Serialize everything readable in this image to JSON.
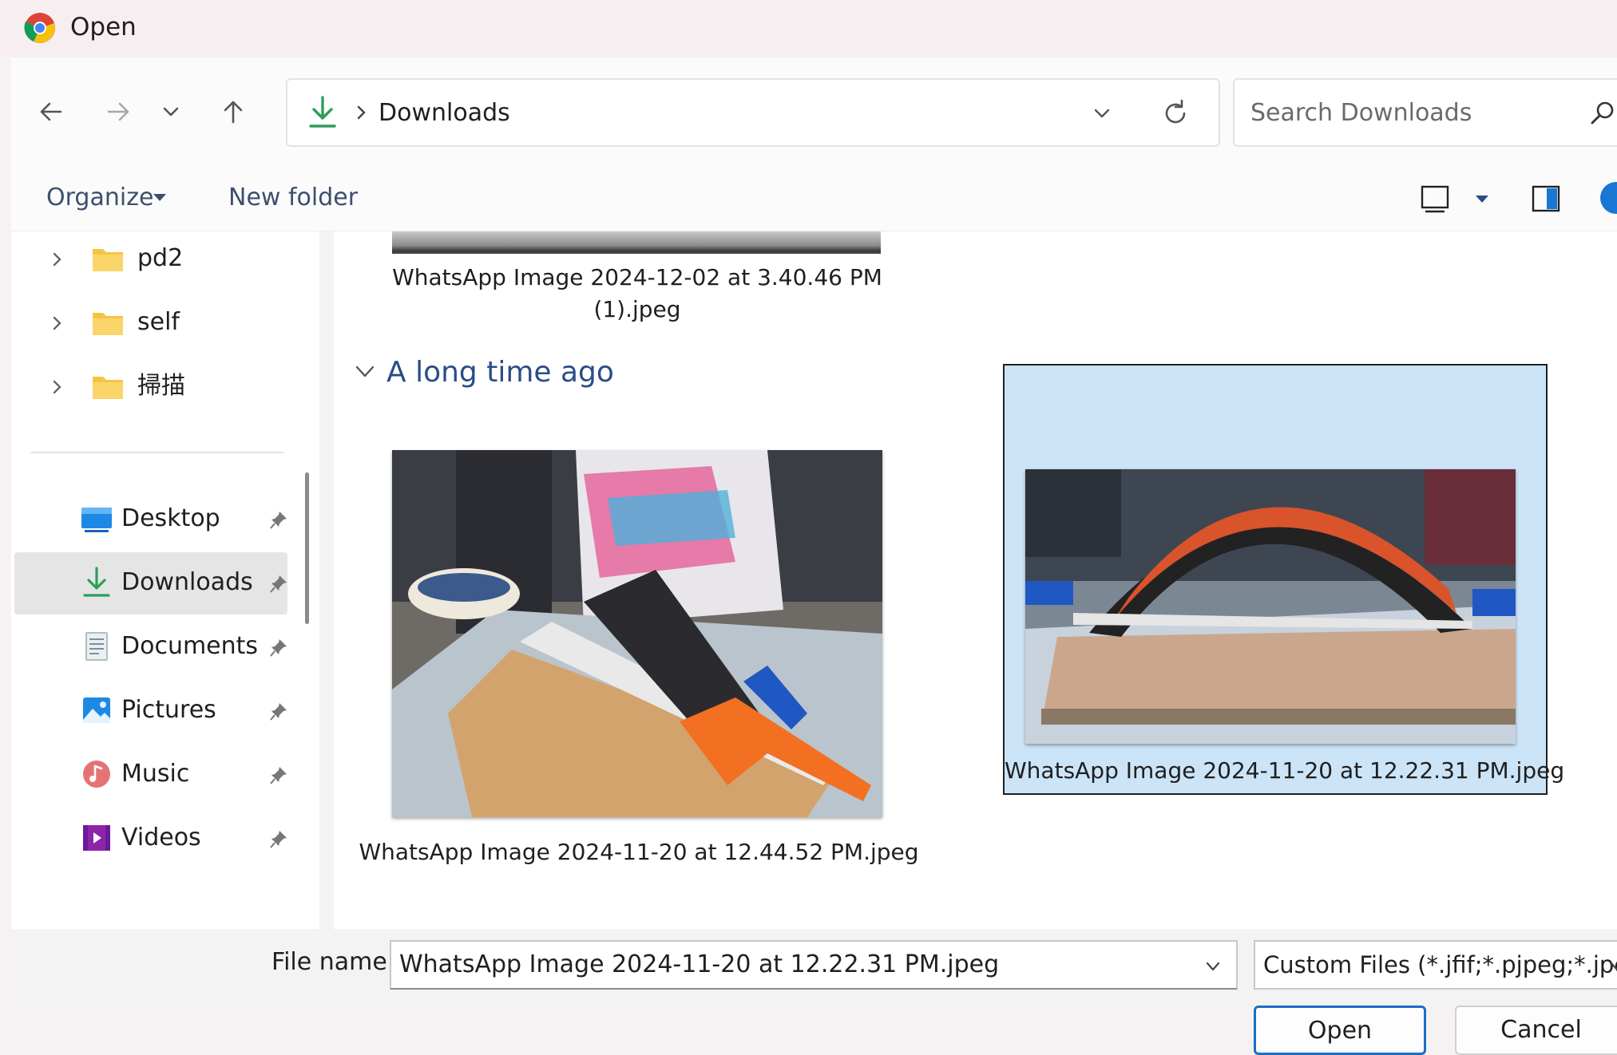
{
  "window": {
    "title": "Open"
  },
  "nav": {
    "address": {
      "location": "Downloads"
    },
    "search": {
      "placeholder": "Search Downloads"
    }
  },
  "toolbar": {
    "organize_label": "Organize",
    "new_folder_label": "New folder"
  },
  "sidebar": {
    "tree": [
      {
        "label": "pd2"
      },
      {
        "label": "self"
      },
      {
        "label": "掃描"
      }
    ],
    "quick_access": [
      {
        "label": "Desktop",
        "icon": "desktop-icon"
      },
      {
        "label": "Downloads",
        "icon": "download-icon",
        "selected": true
      },
      {
        "label": "Documents",
        "icon": "documents-icon"
      },
      {
        "label": "Pictures",
        "icon": "pictures-icon"
      },
      {
        "label": "Music",
        "icon": "music-icon"
      },
      {
        "label": "Videos",
        "icon": "videos-icon"
      }
    ]
  },
  "content": {
    "top_file": {
      "name_line1": "WhatsApp Image 2024-12-02 at 3.40.46 PM",
      "name_line2": "(1).jpeg"
    },
    "group": {
      "label": "A long time ago"
    },
    "files": [
      {
        "name": "WhatsApp Image 2024-11-20 at 12.44.52 PM.jpeg",
        "selected": false
      },
      {
        "name": "WhatsApp Image 2024-11-20 at 12.22.31 PM.jpeg",
        "selected": true
      }
    ]
  },
  "footer": {
    "file_name_label": "File name:",
    "file_name_value": "WhatsApp Image 2024-11-20 at 12.22.31 PM.jpeg",
    "file_type": "Custom Files (*.jfif;*.pjpeg;*.jpe",
    "open_label": "Open",
    "cancel_label": "Cancel"
  },
  "colors": {
    "accent": "#1a6fc4",
    "selection": "#cce4f7",
    "folder": "#f4c542",
    "group_header": "#2b4d86",
    "download_green": "#2e9d5b"
  }
}
